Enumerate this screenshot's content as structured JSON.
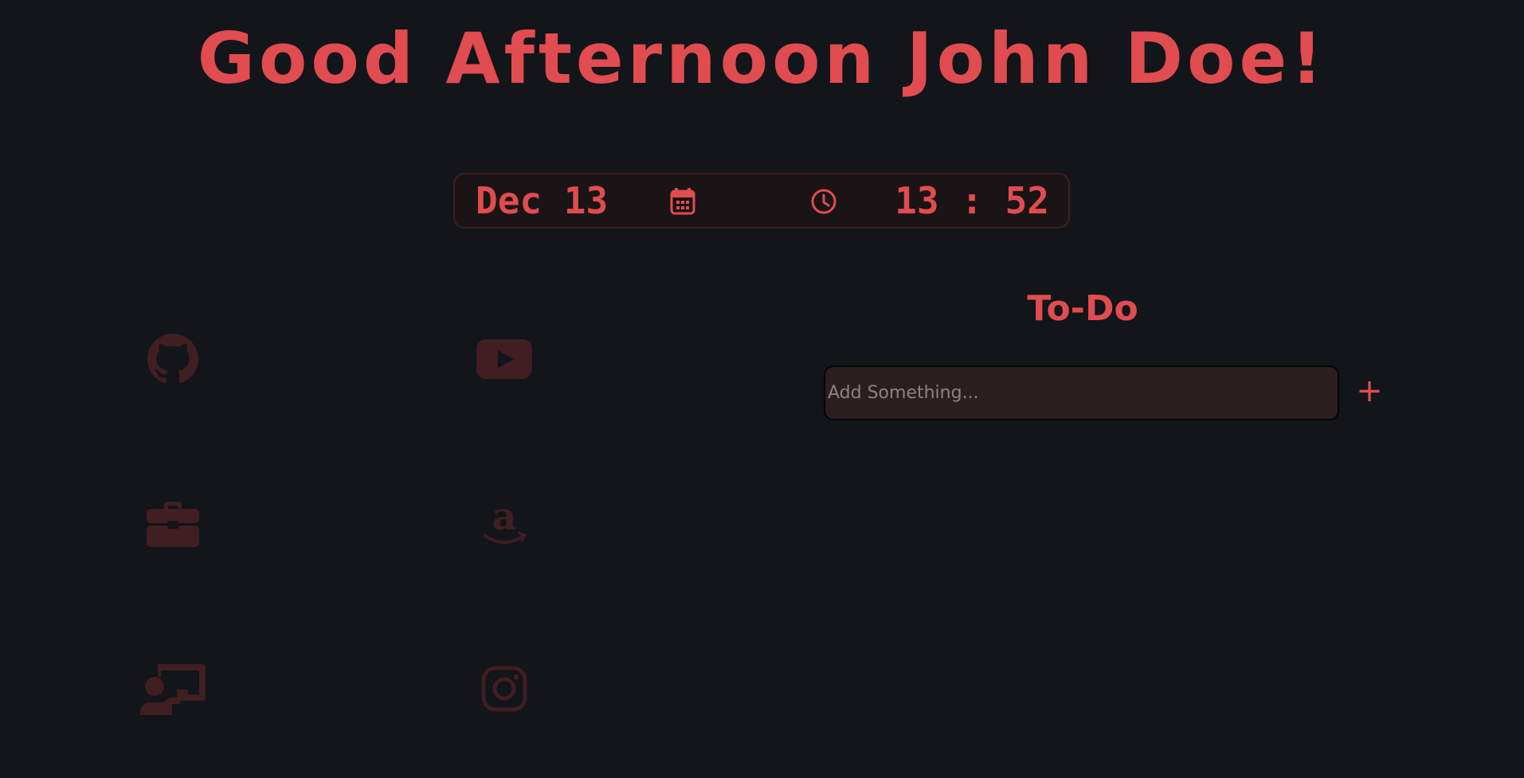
{
  "greeting": "Good Afternoon John Doe!",
  "datetime": {
    "date": "Dec 13",
    "time": "13 : 52",
    "date_icon": "calendar-icon",
    "time_icon": "clock-icon"
  },
  "shortcuts": [
    {
      "name": "github",
      "icon": "github-icon"
    },
    {
      "name": "youtube",
      "icon": "youtube-icon"
    },
    {
      "name": "work",
      "icon": "briefcase-icon"
    },
    {
      "name": "amazon",
      "icon": "amazon-icon"
    },
    {
      "name": "classroom",
      "icon": "chalkboard-teacher-icon"
    },
    {
      "name": "instagram",
      "icon": "instagram-icon"
    }
  ],
  "todo": {
    "title": "To-Do",
    "input_placeholder": "Add Something...",
    "add_label": "+"
  },
  "colors": {
    "background": "#121519",
    "accent": "#e04c4f",
    "muted_icon": "#401e21",
    "input_bg": "#2a1e20"
  }
}
